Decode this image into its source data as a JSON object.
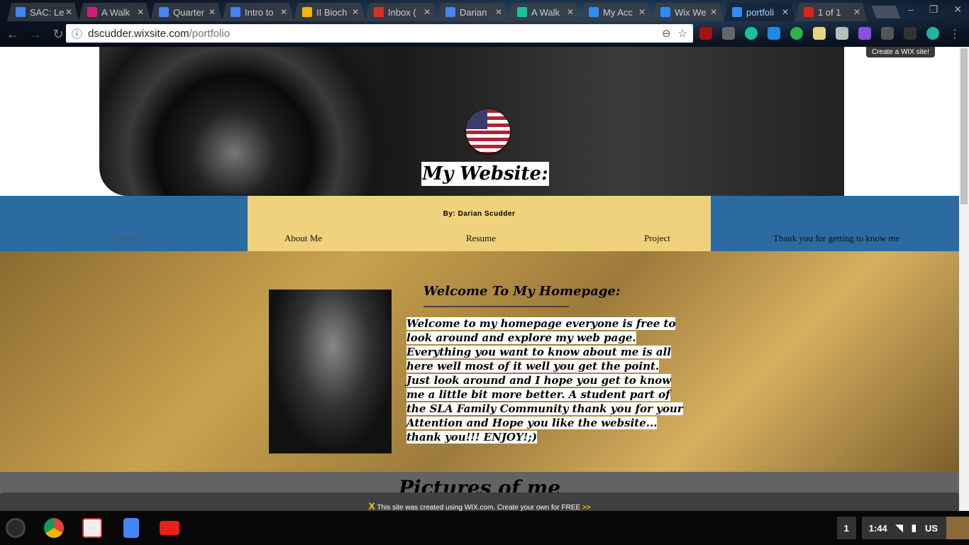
{
  "browser": {
    "tabs": [
      {
        "title": "SAC: Le",
        "icon": "google-docs-icon",
        "color": "#4285f4"
      },
      {
        "title": "A Walk",
        "icon": "magenta-app-icon",
        "color": "#d81b7a"
      },
      {
        "title": "Quarter",
        "icon": "google-docs-icon",
        "color": "#4285f4"
      },
      {
        "title": "Intro to",
        "icon": "google-docs-icon",
        "color": "#4285f4"
      },
      {
        "title": "II Bioch",
        "icon": "google-slides-icon",
        "color": "#f4b400"
      },
      {
        "title": "Inbox (",
        "icon": "gmail-icon",
        "color": "#d93025"
      },
      {
        "title": "Darian",
        "icon": "google-docs-icon",
        "color": "#4285f4"
      },
      {
        "title": "A Walk",
        "icon": "grammarly-icon",
        "color": "#15c39a"
      },
      {
        "title": "My Acc",
        "icon": "wix-icon",
        "color": "#2d8cff"
      },
      {
        "title": "Wix We",
        "icon": "wix-icon",
        "color": "#2d8cff"
      },
      {
        "title": "portfoli",
        "icon": "wix-icon",
        "color": "#2d8cff",
        "active": true
      },
      {
        "title": "1 of 1",
        "icon": "youtube-icon",
        "color": "#e62117"
      }
    ],
    "url_domain": "dscudder.wixsite.com",
    "url_path": "/portfolio"
  },
  "site": {
    "wix_badge": "Create a WIX site!",
    "title": "My Website:",
    "byline": "By: Darian Scudder",
    "menu": [
      "Home",
      "About Me",
      "Resume",
      "Project",
      "Thank you for getting to know me"
    ],
    "welcome_heading": "Welcome To My Homepage:",
    "welcome_text": "Welcome to my homepage everyone is  free to look around and explore my web page. Everything you want to know about me is all here well most of it well you get the point. Just look around and I hope you get to know me a little bit more better. A student part of the SLA Family Community thank you for your Attention and Hope you like the website... thank you!!! ENJOY!;)",
    "pictures_heading": "Pictures of me",
    "wix_footer": "This site was created using WIX.com. Create your own for FREE",
    "wix_footer_arrow": ">>"
  },
  "os": {
    "window_count": "1",
    "time": "1:44",
    "locale": "US"
  }
}
